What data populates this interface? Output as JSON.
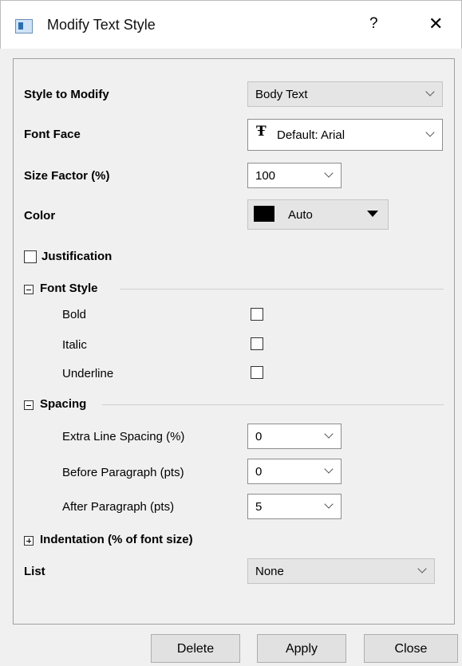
{
  "window": {
    "title": "Modify Text Style",
    "help_label": "?",
    "close_label": "✕"
  },
  "fields": {
    "style_to_modify": {
      "label": "Style to Modify",
      "value": "Body Text"
    },
    "font_face": {
      "label": "Font Face",
      "value": "Default: Arial",
      "icon": "font-icon"
    },
    "size_factor": {
      "label": "Size Factor (%)",
      "value": "100"
    },
    "color": {
      "label": "Color",
      "value": "Auto",
      "swatch_color": "#000000"
    },
    "justification": {
      "label": "Justification",
      "checked": false
    }
  },
  "font_style": {
    "title": "Font Style",
    "bold": {
      "label": "Bold",
      "checked": false
    },
    "italic": {
      "label": "Italic",
      "checked": false
    },
    "underline": {
      "label": "Underline",
      "checked": false
    }
  },
  "spacing": {
    "title": "Spacing",
    "extra_line": {
      "label": "Extra Line Spacing (%)",
      "value": "0"
    },
    "before_paragraph": {
      "label": "Before Paragraph (pts)",
      "value": "0"
    },
    "after_paragraph": {
      "label": "After Paragraph (pts)",
      "value": "5"
    }
  },
  "indentation": {
    "title": "Indentation (% of font size)"
  },
  "list": {
    "label": "List",
    "value": "None"
  },
  "buttons": {
    "delete": "Delete",
    "apply": "Apply",
    "close": "Close"
  }
}
